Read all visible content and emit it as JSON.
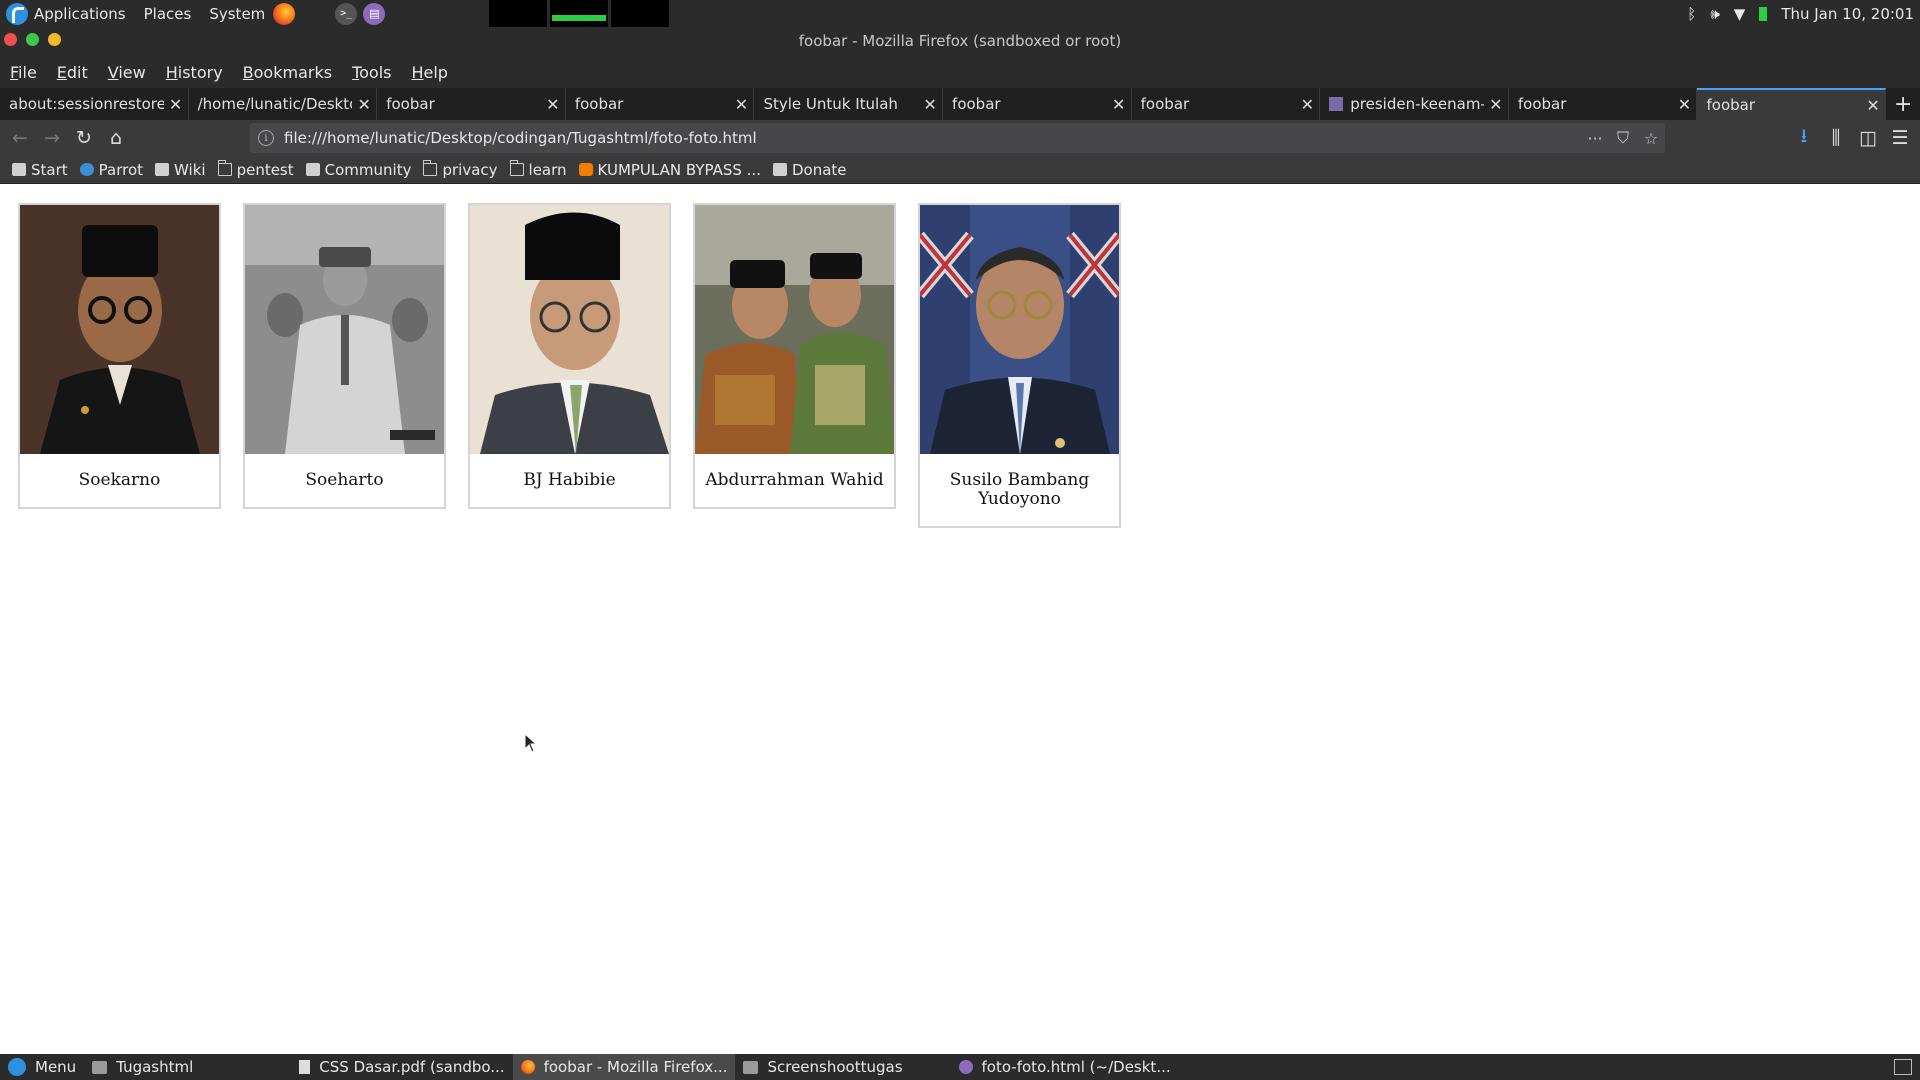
{
  "system_panel": {
    "menus": [
      "Applications",
      "Places",
      "System"
    ],
    "clock": "Thu Jan 10, 20:01"
  },
  "window": {
    "title": "foobar - Mozilla Firefox (sandboxed or root)"
  },
  "menubar": {
    "items": [
      {
        "underline": "F",
        "rest": "ile"
      },
      {
        "underline": "E",
        "rest": "dit"
      },
      {
        "underline": "V",
        "rest": "iew"
      },
      {
        "underline": "H",
        "rest": "istory"
      },
      {
        "underline": "B",
        "rest": "ookmarks"
      },
      {
        "underline": "T",
        "rest": "ools"
      },
      {
        "underline": "H",
        "rest": "elp"
      }
    ]
  },
  "tabs": [
    {
      "label": "about:sessionrestore",
      "close": "✕"
    },
    {
      "label": "/home/lunatic/Desktop",
      "close": "✕"
    },
    {
      "label": "foobar",
      "close": "✕"
    },
    {
      "label": "foobar",
      "close": "✕"
    },
    {
      "label": "Style Untuk Itulah",
      "close": "✕"
    },
    {
      "label": "foobar",
      "close": "✕"
    },
    {
      "label": "foobar",
      "close": "✕"
    },
    {
      "label": "presiden-keenam-",
      "close": "✕"
    },
    {
      "label": "foobar",
      "close": "✕"
    },
    {
      "label": "foobar",
      "close": "✕"
    }
  ],
  "newtab_label": "+",
  "urlbar": {
    "url": "file:///home/lunatic/Desktop/codingan/Tugashtml/foto-foto.html",
    "info_glyph": "i",
    "more_glyph": "···",
    "pocket_glyph": "⛉",
    "star_glyph": "☆"
  },
  "nav": {
    "back_glyph": "←",
    "forward_glyph": "→",
    "reload_glyph": "↻",
    "home_glyph": "⌂",
    "download_glyph": "⭳",
    "library_glyph": "⫼",
    "sidebar_glyph": "◫",
    "menu_glyph": "☰"
  },
  "bookmarks": [
    {
      "label": "Start",
      "icon": "wiki"
    },
    {
      "label": "Parrot",
      "icon": "parrot"
    },
    {
      "label": "Wiki",
      "icon": "wiki"
    },
    {
      "label": "pentest",
      "icon": "folder"
    },
    {
      "label": "Community",
      "icon": "wiki"
    },
    {
      "label": "privacy",
      "icon": "folder"
    },
    {
      "label": "learn",
      "icon": "folder"
    },
    {
      "label": "KUMPULAN BYPASS ...",
      "icon": "blogger"
    },
    {
      "label": "Donate",
      "icon": "wiki"
    }
  ],
  "gallery": [
    {
      "caption": "Soekarno"
    },
    {
      "caption": "Soeharto"
    },
    {
      "caption": "BJ Habibie"
    },
    {
      "caption": "Abdurrahman Wahid"
    },
    {
      "caption": "Susilo Bambang Yudoyono"
    }
  ],
  "taskbar": {
    "menu_label": "Menu",
    "tasks": [
      {
        "label": "Tugashtml",
        "icon": "folder"
      },
      {
        "label": "CSS Dasar.pdf (sandbo...",
        "icon": "doc"
      },
      {
        "label": "foobar - Mozilla Firefox...",
        "icon": "ff"
      },
      {
        "label": "Screenshoottugas",
        "icon": "folder"
      },
      {
        "label": "foto-foto.html (~/Deskt...",
        "icon": "edit"
      }
    ]
  },
  "colors": {
    "panel_bg": "#2b2b2b",
    "tab_active_accent": "#44a3ff",
    "close_red": "#f0504f",
    "min_green": "#3ec84a",
    "max_yellow": "#f2b92c"
  }
}
